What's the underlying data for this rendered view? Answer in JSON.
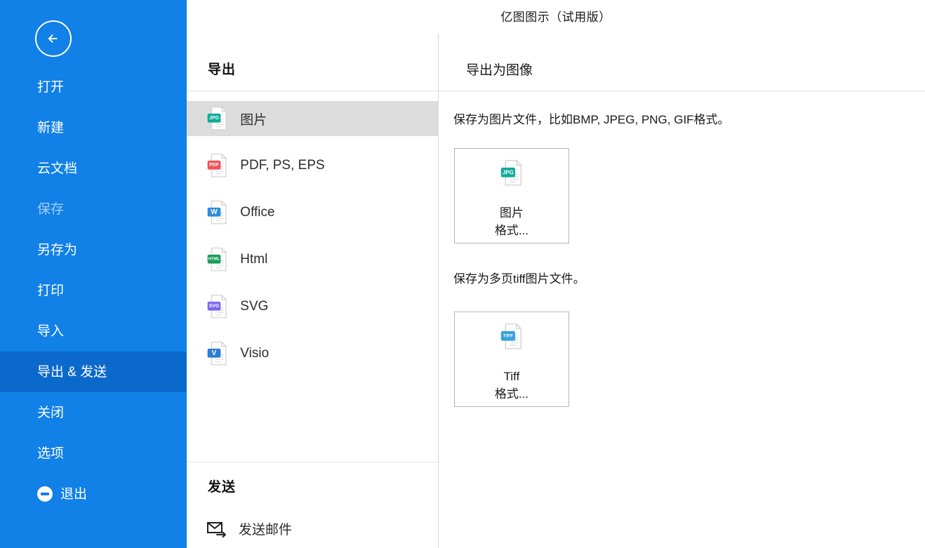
{
  "window": {
    "title": "亿图图示（试用版）"
  },
  "colors": {
    "sidebar_blue": "#1180e7",
    "sidebar_selected_blue": "#0b69cc",
    "list_selected_gray": "#dcdcdc",
    "jpg_badge": "#11a99b",
    "pdf_badge": "#f4505a",
    "office_badge": "#2d8ce0",
    "html_badge": "#1a9c5b",
    "svg_badge": "#7b68ee",
    "visio_badge": "#2b7cd3",
    "tiff_badge": "#38a1dd"
  },
  "sidebar": {
    "back_icon": "arrow-left-circle-icon",
    "items": [
      {
        "label": "打开",
        "name": "open",
        "state": "normal"
      },
      {
        "label": "新建",
        "name": "new",
        "state": "normal"
      },
      {
        "label": "云文档",
        "name": "cloud-docs",
        "state": "normal"
      },
      {
        "label": "保存",
        "name": "save",
        "state": "disabled"
      },
      {
        "label": "另存为",
        "name": "save-as",
        "state": "normal"
      },
      {
        "label": "打印",
        "name": "print",
        "state": "normal"
      },
      {
        "label": "导入",
        "name": "import",
        "state": "normal"
      },
      {
        "label": "导出 & 发送",
        "name": "export-send",
        "state": "selected"
      },
      {
        "label": "关闭",
        "name": "close",
        "state": "normal"
      },
      {
        "label": "选项",
        "name": "options",
        "state": "normal"
      },
      {
        "label": "退出",
        "name": "exit",
        "state": "normal",
        "icon": "exit-circle-icon"
      }
    ]
  },
  "export_panel": {
    "heading": "导出",
    "items": [
      {
        "label": "图片",
        "icon": "jpg-file-icon",
        "badge": "JPG",
        "selected": true
      },
      {
        "label": "PDF, PS, EPS",
        "icon": "pdf-file-icon",
        "badge": "PDF",
        "selected": false
      },
      {
        "label": "Office",
        "icon": "office-file-icon",
        "badge": "W",
        "selected": false
      },
      {
        "label": "Html",
        "icon": "html-file-icon",
        "badge": "HTML",
        "selected": false
      },
      {
        "label": "SVG",
        "icon": "svg-file-icon",
        "badge": "SVG",
        "selected": false
      },
      {
        "label": "Visio",
        "icon": "visio-file-icon",
        "badge": "V",
        "selected": false
      }
    ],
    "send_heading": "发送",
    "send_items": [
      {
        "label": "发送邮件",
        "icon": "envelope-send-icon"
      }
    ]
  },
  "detail_panel": {
    "heading": "导出为图像",
    "description_1": "保存为图片文件，比如BMP, JPEG, PNG, GIF格式。",
    "description_2": "保存为多页tiff图片文件。",
    "cards": [
      {
        "line1": "图片",
        "line2": "格式...",
        "icon": "jpg-file-icon",
        "badge": "JPG"
      },
      {
        "line1": "Tiff",
        "line2": "格式...",
        "icon": "tiff-file-icon",
        "badge": "TIFF"
      }
    ]
  }
}
